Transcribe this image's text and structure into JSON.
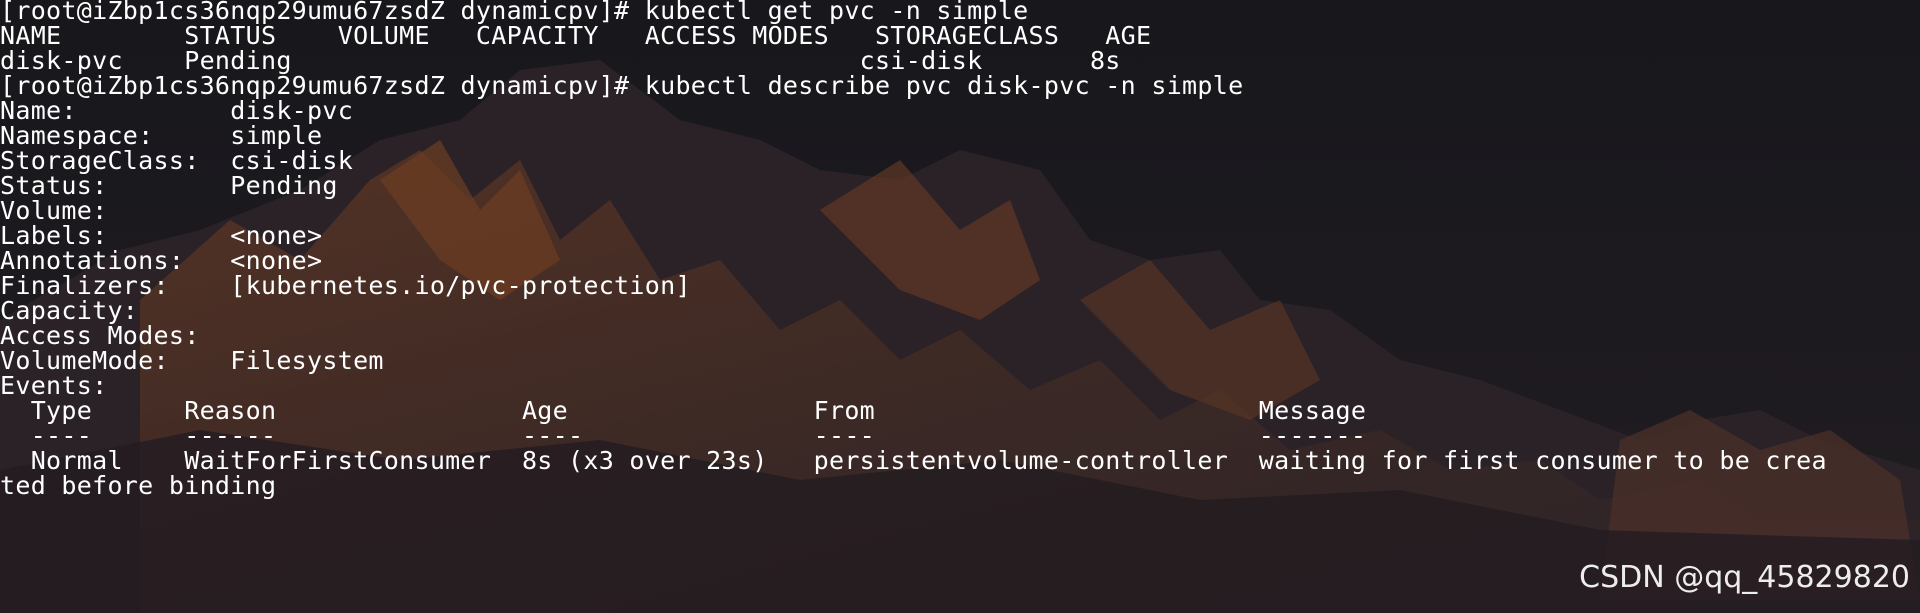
{
  "terminal": {
    "lines": [
      "[root@iZbp1cs36nqp29umu67zsdZ dynamicpv]# kubectl get pvc -n simple",
      "NAME        STATUS    VOLUME   CAPACITY   ACCESS MODES   STORAGECLASS   AGE",
      "disk-pvc    Pending                                     csi-disk       8s",
      "[root@iZbp1cs36nqp29umu67zsdZ dynamicpv]# kubectl describe pvc disk-pvc -n simple",
      "Name:          disk-pvc",
      "Namespace:     simple",
      "StorageClass:  csi-disk",
      "Status:        Pending",
      "Volume:",
      "Labels:        <none>",
      "Annotations:   <none>",
      "Finalizers:    [kubernetes.io/pvc-protection]",
      "Capacity:",
      "Access Modes:",
      "VolumeMode:    Filesystem",
      "Events:",
      "  Type      Reason                Age                From                         Message",
      "  ----      ------                ----               ----                         -------",
      "  Normal    WaitForFirstConsumer  8s (x3 over 23s)   persistentvolume-controller  waiting for first consumer to be crea",
      "ted before binding"
    ]
  },
  "watermark": "CSDN @qq_45829820"
}
